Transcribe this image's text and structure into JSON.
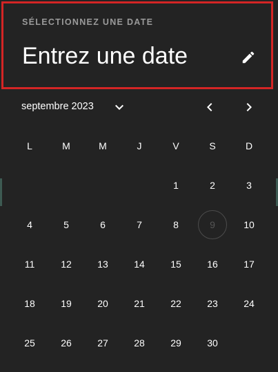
{
  "header": {
    "label": "SÉLECTIONNEZ UNE DATE",
    "title": "Entrez une date",
    "edit_icon": "pencil-icon"
  },
  "navigation": {
    "month_year": "septembre 2023",
    "year_toggle_icon": "chevron-down-icon",
    "prev_icon": "chevron-left-icon",
    "next_icon": "chevron-right-icon"
  },
  "weekdays": [
    "L",
    "M",
    "M",
    "J",
    "V",
    "S",
    "D"
  ],
  "weeks": [
    [
      "",
      "",
      "",
      "",
      "1",
      "2",
      "3"
    ],
    [
      "4",
      "5",
      "6",
      "7",
      "8",
      "9",
      "10"
    ],
    [
      "11",
      "12",
      "13",
      "14",
      "15",
      "16",
      "17"
    ],
    [
      "18",
      "19",
      "20",
      "21",
      "22",
      "23",
      "24"
    ],
    [
      "25",
      "26",
      "27",
      "28",
      "29",
      "30",
      ""
    ]
  ],
  "today": "9",
  "colors": {
    "background": "#232323",
    "highlight_border": "#d42525",
    "text": "#ffffff",
    "muted": "#9a9a9a"
  }
}
